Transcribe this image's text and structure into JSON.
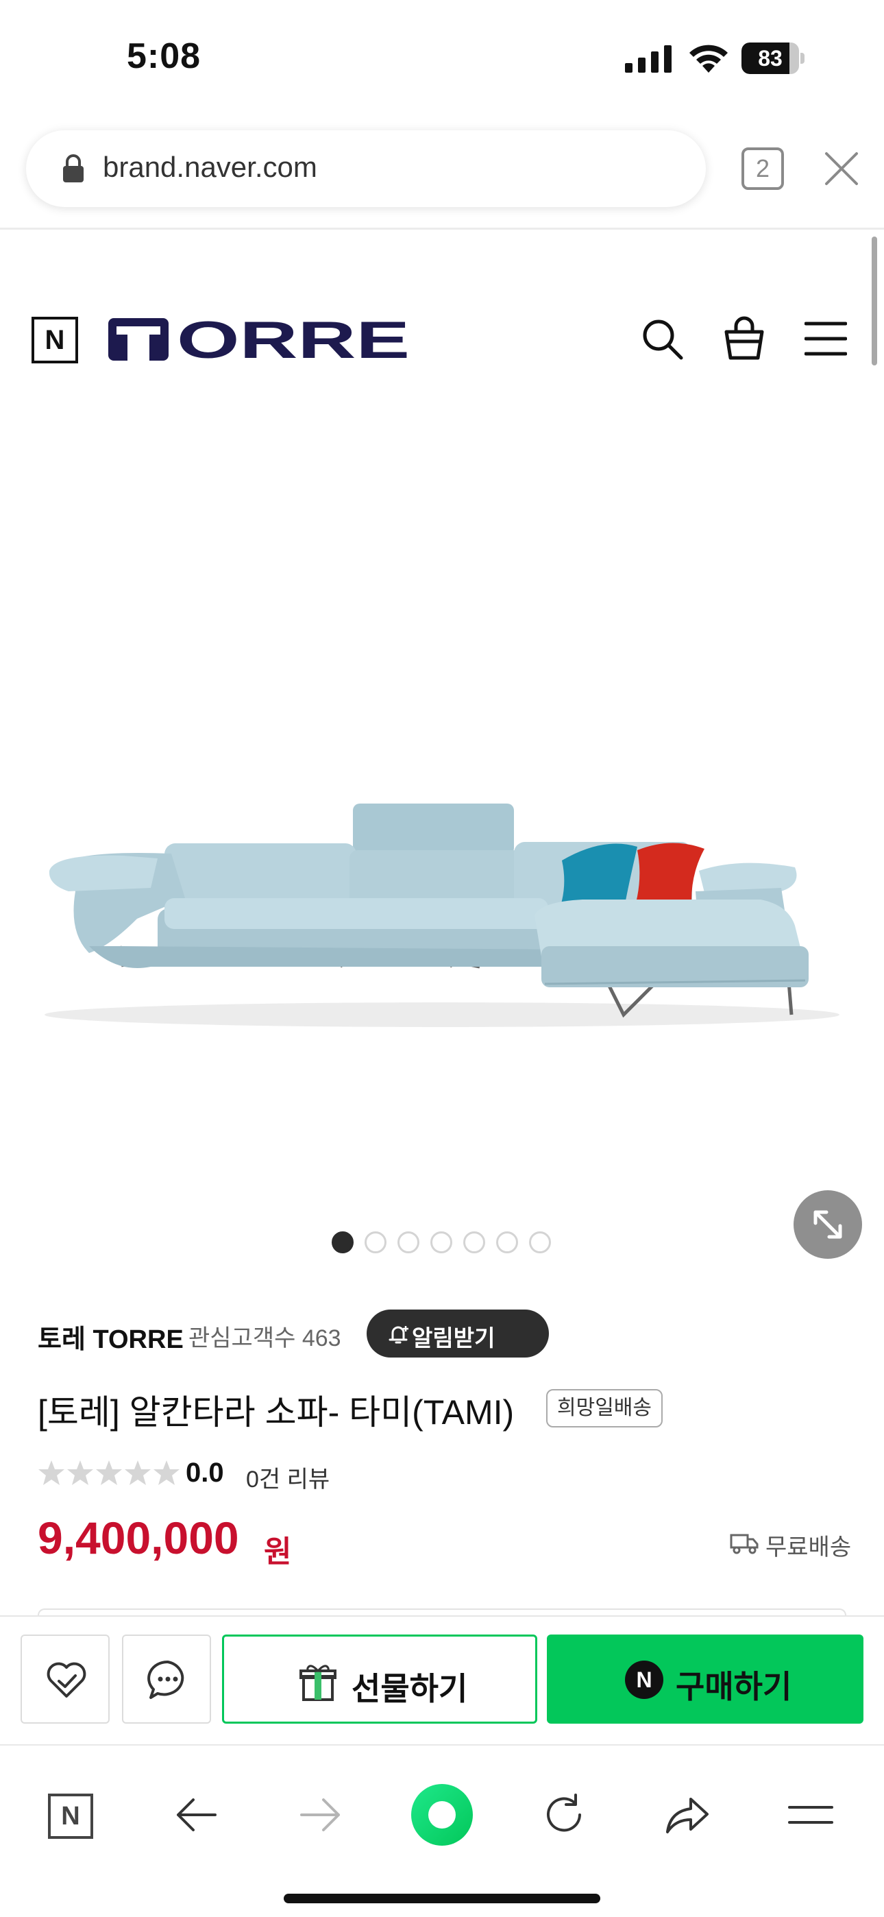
{
  "status_bar": {
    "time": "5:08",
    "battery": "83",
    "battery_level": 0.83
  },
  "browser": {
    "url": "brand.naver.com",
    "tab_count": "2"
  },
  "header": {
    "logo_badge": "N",
    "brand_logo": "TORRE",
    "icons": [
      "search-icon",
      "cart-icon",
      "menu-icon"
    ]
  },
  "gallery": {
    "slide_count": 7,
    "active_index": 0
  },
  "product": {
    "brand": "토레 TORRE",
    "followers": "관심고객수 463",
    "notify_label": "알림받기",
    "title": "[토레] 알칸타라 소파- 타미(TAMI)",
    "delivery_badge": "희망일배송",
    "rating": "0.0",
    "rating_stars": 0,
    "reviews": "0건 리뷰",
    "price": "9,400,000",
    "currency": "원",
    "shipping": "무료배송"
  },
  "actions": {
    "gift_label": "선물하기",
    "buy_badge": "N",
    "buy_label": "구매하기"
  },
  "toolbar": {
    "home_badge": "N",
    "items": [
      "home-icon",
      "back-icon",
      "forward-icon",
      "green-dot-icon",
      "reload-icon",
      "share-icon",
      "menu-icon"
    ]
  },
  "colors": {
    "accent_green": "#03c75a",
    "price_red": "#c8102e",
    "brand_navy": "#1d1a4e",
    "sofa_blue": "#b8d3dd",
    "pillow_teal": "#1a8fb0",
    "pillow_red": "#d42a1e"
  }
}
